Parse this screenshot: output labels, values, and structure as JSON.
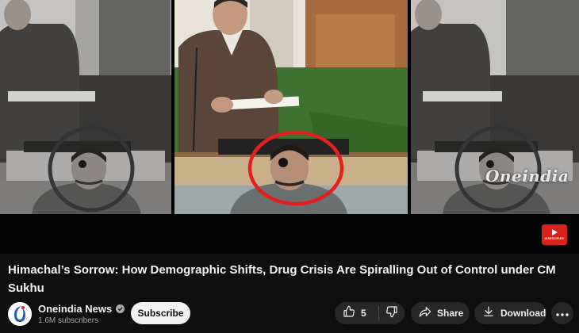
{
  "video": {
    "watermark": "Oneindia",
    "title": "Himachal’s Sorrow: How Demographic Shifts, Drug Crisis Are Spiralling Out of Control under CM Sukhu"
  },
  "channel": {
    "name": "Oneindia News",
    "subscribers": "1.6M subscribers",
    "subscribe_label": "Subscribe"
  },
  "actions": {
    "like_count": "5",
    "share_label": "Share",
    "download_label": "Download"
  },
  "colors": {
    "background": "#0f0f0f",
    "highlight_circle": "#e3201b",
    "subscribe_bg": "#f1f1f1",
    "pill_bg": "#272727"
  },
  "icons": [
    "verified-icon",
    "like-icon",
    "dislike-icon",
    "share-icon",
    "download-icon",
    "more-icon",
    "subscribe-logo-icon"
  ]
}
